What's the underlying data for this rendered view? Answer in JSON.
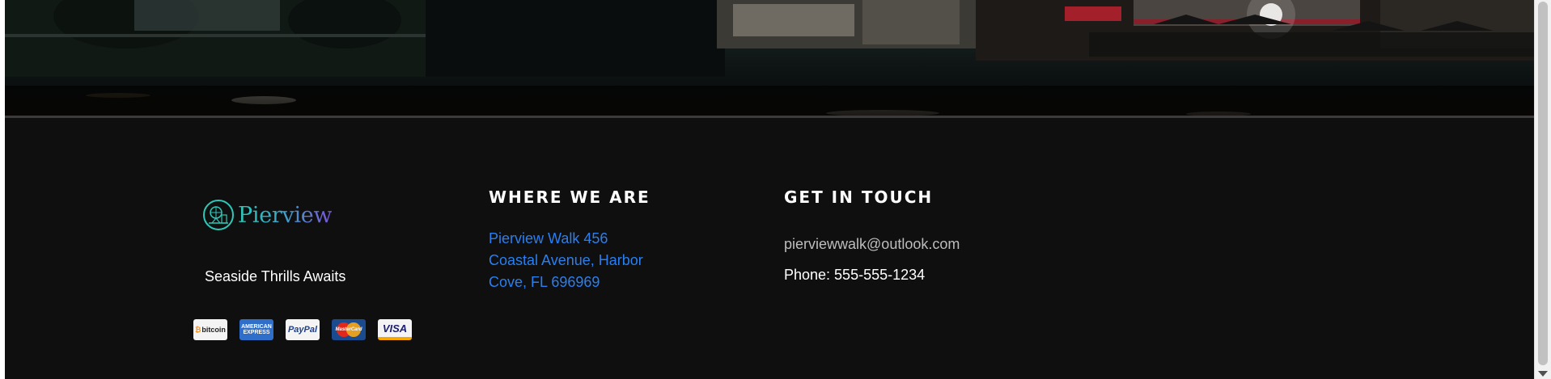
{
  "hero": {
    "image_description_icon": "night-pier-photo"
  },
  "footer": {
    "logo_text": "Pierview",
    "tagline": "Seaside Thrills Awaits",
    "payments": [
      {
        "name": "bitcoin",
        "label": "bitcoin"
      },
      {
        "name": "amex",
        "label": "AMERICAN EXPRESS"
      },
      {
        "name": "paypal",
        "label": "PayPal"
      },
      {
        "name": "mastercard",
        "label": "MasterCard"
      },
      {
        "name": "visa",
        "label": "VISA"
      }
    ],
    "where_heading": "WHERE WE ARE",
    "address_lines": [
      "Pierview Walk 456",
      "Coastal Avenue, Harbor",
      "Cove, FL 696969"
    ],
    "touch_heading": "GET IN TOUCH",
    "email": "pierviewwalk@outlook.com",
    "phone": "Phone: 555-555-1234"
  },
  "colors": {
    "footer_bg": "#0f0f10",
    "link_blue": "#2a7ff0",
    "logo_gradient_start": "#2fc7b6",
    "logo_gradient_end": "#7b55d6"
  }
}
